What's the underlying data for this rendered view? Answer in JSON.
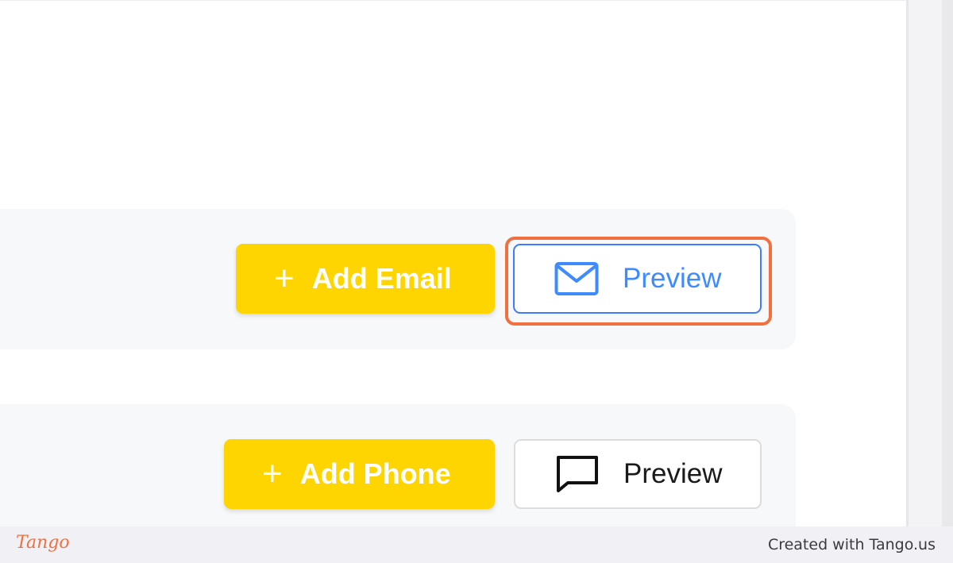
{
  "email_section": {
    "add_label": "Add Email",
    "add_icon": "plus-icon",
    "preview_label": "Preview",
    "preview_icon": "envelope-icon",
    "accent_color": "#3d7bff"
  },
  "phone_section": {
    "add_label": "Add Phone",
    "add_icon": "plus-icon",
    "preview_label": "Preview",
    "preview_icon": "speech-bubble-icon"
  },
  "colors": {
    "add_button": "#ffd500",
    "highlight": "#f26f3f"
  },
  "footer": {
    "logo": "Tango",
    "credit": "Created with Tango.us"
  }
}
